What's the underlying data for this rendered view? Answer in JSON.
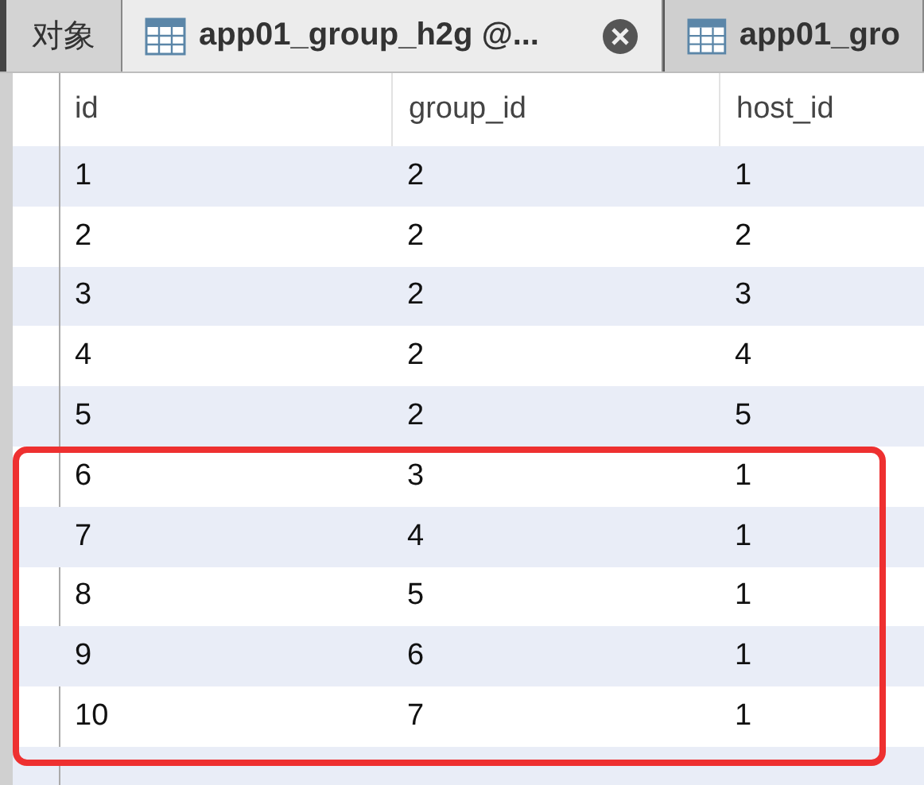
{
  "tabs": [
    {
      "kind": "plain",
      "label": "对象",
      "selected": false
    },
    {
      "kind": "table",
      "label": "app01_group_h2g @...",
      "selected": true,
      "closable": true
    },
    {
      "kind": "table",
      "label": "app01_gro",
      "selected": false,
      "closable": false
    }
  ],
  "table": {
    "columns": [
      "id",
      "group_id",
      "host_id"
    ],
    "rows": [
      {
        "cells": [
          "1",
          "2",
          "1"
        ],
        "highlighted": false
      },
      {
        "cells": [
          "2",
          "2",
          "2"
        ],
        "highlighted": false
      },
      {
        "cells": [
          "3",
          "2",
          "3"
        ],
        "highlighted": false
      },
      {
        "cells": [
          "4",
          "2",
          "4"
        ],
        "highlighted": false
      },
      {
        "cells": [
          "5",
          "2",
          "5"
        ],
        "highlighted": false
      },
      {
        "cells": [
          "6",
          "3",
          "1"
        ],
        "highlighted": true
      },
      {
        "cells": [
          "7",
          "4",
          "1"
        ],
        "highlighted": true
      },
      {
        "cells": [
          "8",
          "5",
          "1"
        ],
        "highlighted": true
      },
      {
        "cells": [
          "9",
          "6",
          "1"
        ],
        "highlighted": true
      },
      {
        "cells": [
          "10",
          "7",
          "1"
        ],
        "highlighted": true
      }
    ]
  }
}
